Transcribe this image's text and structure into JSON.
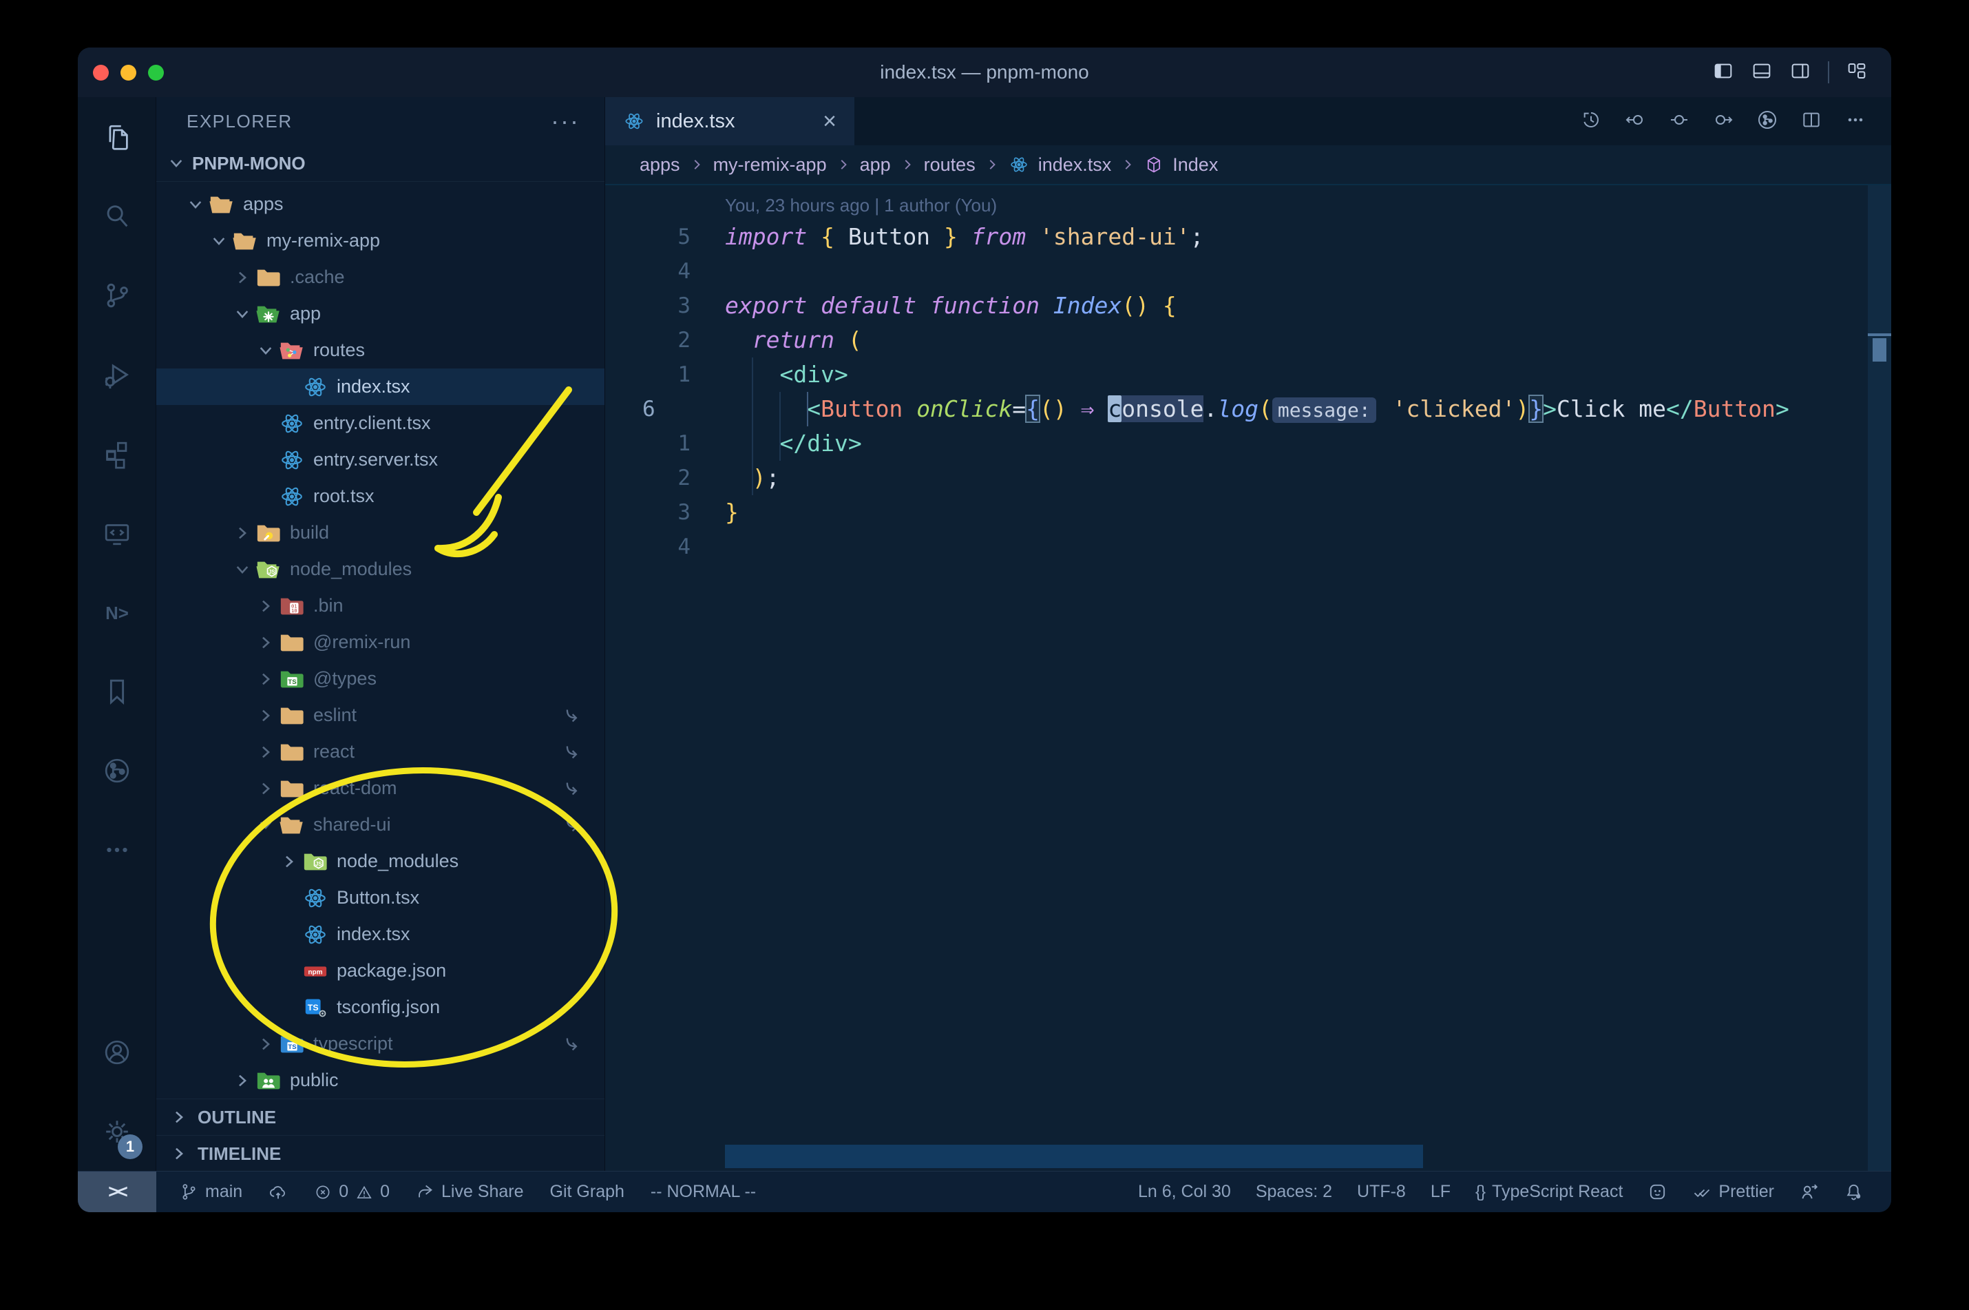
{
  "window": {
    "title": "index.tsx — pnpm-mono"
  },
  "activity_bar": {
    "settings_badge": "1"
  },
  "sidebar": {
    "header": "EXPLORER",
    "header_more": "···",
    "project": "PNPM-MONO",
    "outline": "OUTLINE",
    "timeline": "TIMELINE",
    "tree": [
      {
        "label": "apps",
        "lvl": 1,
        "icon": "folder-tan",
        "chev": "open"
      },
      {
        "label": "my-remix-app",
        "lvl": 2,
        "icon": "folder-tan",
        "chev": "open"
      },
      {
        "label": ".cache",
        "lvl": 3,
        "icon": "folder-tan",
        "chev": "closed",
        "dim": true
      },
      {
        "label": "app",
        "lvl": 3,
        "icon": "folder-app",
        "chev": "open"
      },
      {
        "label": "routes",
        "lvl": 4,
        "icon": "folder-routes",
        "chev": "open"
      },
      {
        "label": "index.tsx",
        "lvl": 5,
        "icon": "react",
        "sel": true
      },
      {
        "label": "entry.client.tsx",
        "lvl": 4,
        "icon": "react"
      },
      {
        "label": "entry.server.tsx",
        "lvl": 4,
        "icon": "react"
      },
      {
        "label": "root.tsx",
        "lvl": 4,
        "icon": "react"
      },
      {
        "label": "build",
        "lvl": 3,
        "icon": "folder-build",
        "chev": "closed",
        "dim": true
      },
      {
        "label": "node_modules",
        "lvl": 3,
        "icon": "folder-node",
        "chev": "open",
        "dim": true
      },
      {
        "label": ".bin",
        "lvl": 4,
        "icon": "folder-bin",
        "chev": "closed",
        "dim": true
      },
      {
        "label": "@remix-run",
        "lvl": 4,
        "icon": "folder-tan",
        "chev": "closed",
        "dim": true
      },
      {
        "label": "@types",
        "lvl": 4,
        "icon": "folder-types",
        "chev": "closed",
        "dim": true
      },
      {
        "label": "eslint",
        "lvl": 4,
        "icon": "folder-tan",
        "chev": "closed",
        "dim": true,
        "link": true
      },
      {
        "label": "react",
        "lvl": 4,
        "icon": "folder-tan",
        "chev": "closed",
        "dim": true,
        "link": true
      },
      {
        "label": "react-dom",
        "lvl": 4,
        "icon": "folder-tan",
        "chev": "closed",
        "dim": true,
        "link": true
      },
      {
        "label": "shared-ui",
        "lvl": 4,
        "icon": "folder-tan",
        "chev": "open",
        "dim": true,
        "link": true
      },
      {
        "label": "node_modules",
        "lvl": 5,
        "icon": "folder-node",
        "chev": "closed"
      },
      {
        "label": "Button.tsx",
        "lvl": 5,
        "icon": "react"
      },
      {
        "label": "index.tsx",
        "lvl": 5,
        "icon": "react"
      },
      {
        "label": "package.json",
        "lvl": 5,
        "icon": "npm"
      },
      {
        "label": "tsconfig.json",
        "lvl": 5,
        "icon": "ts-config"
      },
      {
        "label": "typescript",
        "lvl": 4,
        "icon": "folder-ts",
        "chev": "closed",
        "dim": true,
        "link": true
      },
      {
        "label": "public",
        "lvl": 3,
        "icon": "folder-public",
        "chev": "closed"
      }
    ]
  },
  "editor": {
    "tab": "index.tsx",
    "tab_close": "×",
    "breadcrumbs": [
      "apps",
      "my-remix-app",
      "app",
      "routes",
      "index.tsx",
      "Index"
    ],
    "blame": "You, 23 hours ago | 1 author (You)",
    "code_lines": [
      {
        "num": "5",
        "tokens": [
          [
            "kwi",
            "import"
          ],
          [
            "fg",
            " "
          ],
          [
            "brY",
            "{"
          ],
          [
            "fg",
            " "
          ],
          [
            "fg",
            "Button"
          ],
          [
            "fg",
            " "
          ],
          [
            "brY",
            "}"
          ],
          [
            "fg",
            " "
          ],
          [
            "kwi",
            "from"
          ],
          [
            "fg",
            " "
          ],
          [
            "str",
            "'shared-ui'"
          ],
          [
            "fg",
            ";"
          ]
        ]
      },
      {
        "num": "4",
        "tokens": []
      },
      {
        "num": "3",
        "tokens": [
          [
            "kwi",
            "export"
          ],
          [
            "fg",
            " "
          ],
          [
            "kwi",
            "default"
          ],
          [
            "fg",
            " "
          ],
          [
            "kwi",
            "function"
          ],
          [
            "fg",
            " "
          ],
          [
            "fni",
            "Index"
          ],
          [
            "brY",
            "()"
          ],
          [
            "fg",
            " "
          ],
          [
            "brY",
            "{"
          ]
        ]
      },
      {
        "num": "2",
        "tokens": [
          [
            "fg",
            "  "
          ],
          [
            "kwi",
            "return"
          ],
          [
            "fg",
            " "
          ],
          [
            "brY",
            "("
          ]
        ]
      },
      {
        "num": "1",
        "tokens": [
          [
            "fg",
            "    "
          ],
          [
            "tag",
            "<div>"
          ]
        ]
      },
      {
        "num": "6",
        "current": true,
        "tokens": [
          [
            "fg",
            "      "
          ],
          [
            "tag",
            "<"
          ],
          [
            "comp",
            "Button"
          ],
          [
            "fg",
            " "
          ],
          [
            "attr",
            "onClick"
          ],
          [
            "fg",
            "="
          ],
          [
            "boxB",
            "{"
          ],
          [
            "brY",
            "()"
          ],
          [
            "fg",
            " "
          ],
          [
            "arr",
            "⇒"
          ],
          [
            "fg",
            " "
          ],
          [
            "cur",
            "c"
          ],
          [
            "occ",
            "onsole"
          ],
          [
            "fg",
            "."
          ],
          [
            "fni",
            "log"
          ],
          [
            "brY",
            "("
          ],
          [
            "inlay",
            "message:"
          ],
          [
            "fg",
            " "
          ],
          [
            "str",
            "'clicked'"
          ],
          [
            "brY",
            ")"
          ],
          [
            "boxB",
            "}"
          ],
          [
            "tag",
            ">"
          ],
          [
            "fg",
            "Click me"
          ],
          [
            "tag",
            "</"
          ],
          [
            "comp",
            "Button"
          ],
          [
            "tag",
            ">"
          ]
        ]
      },
      {
        "num": "1",
        "tokens": [
          [
            "fg",
            "    "
          ],
          [
            "tag",
            "</div>"
          ]
        ]
      },
      {
        "num": "2",
        "tokens": [
          [
            "fg",
            "  "
          ],
          [
            "brY",
            ")"
          ],
          [
            "fg",
            ";"
          ]
        ]
      },
      {
        "num": "3",
        "tokens": [
          [
            "brY",
            "}"
          ]
        ]
      },
      {
        "num": "4",
        "tokens": []
      }
    ]
  },
  "status_bar": {
    "remote": "><",
    "branch": "main",
    "errors": "0",
    "warnings": "0",
    "live_share": "Live Share",
    "git_graph": "Git Graph",
    "vim_mode": "-- NORMAL --",
    "line_col": "Ln 6, Col 30",
    "indentation": "Spaces: 2",
    "encoding": "UTF-8",
    "eol": "LF",
    "brackets": "{}",
    "language": "TypeScript React",
    "formatter": "Prettier"
  },
  "colors": {
    "annotation_yellow": "#f2e51e",
    "traffic_red": "#ff5f57",
    "traffic_yellow": "#febc2e",
    "traffic_green": "#28c840",
    "editor_bg": "#0d2033",
    "sidebar_bg": "#0c1b2e",
    "activity_bg": "#0b1828",
    "titlebar_bg": "#101c2e",
    "statusbar_bg": "#0d1f35",
    "keyword": "#c792ea",
    "string": "#ecc48d",
    "function": "#82aaff",
    "tag": "#7fdbca",
    "component": "#f08a76",
    "attribute": "#addb67",
    "bracket_gold": "#fdd263"
  }
}
